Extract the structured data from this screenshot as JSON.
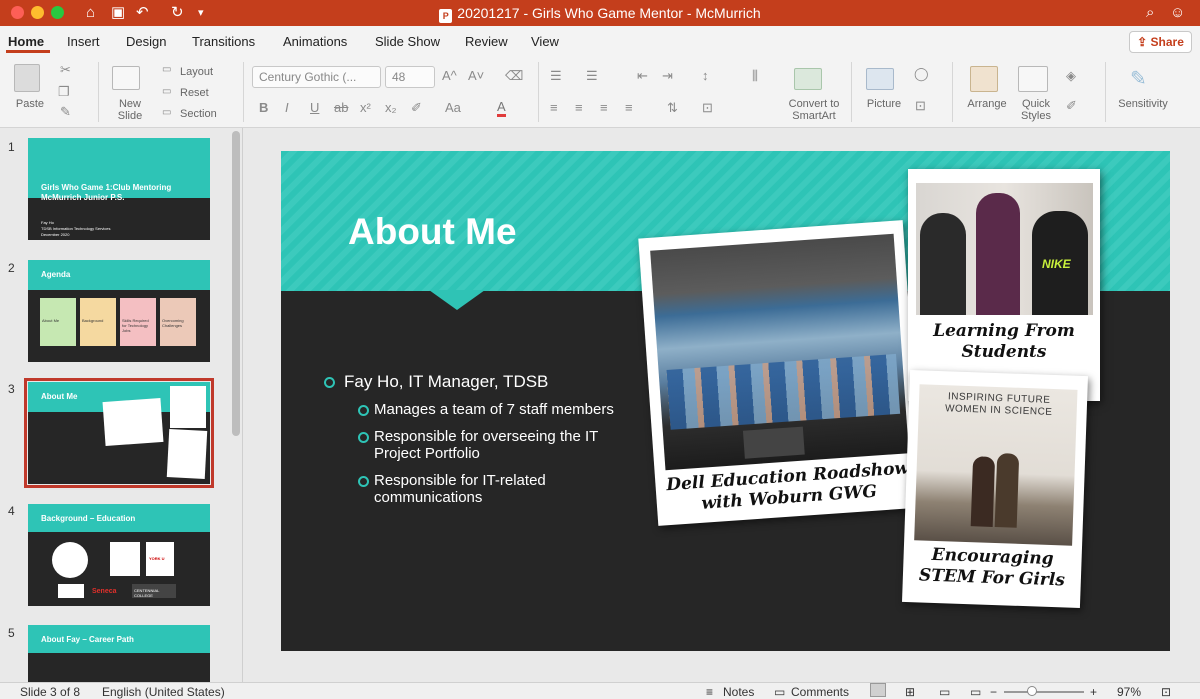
{
  "app": {
    "title": "20201217 - Girls Who Game Mentor - McMurrich",
    "ppt_mark": "P"
  },
  "tabs": [
    "Home",
    "Insert",
    "Design",
    "Transitions",
    "Animations",
    "Slide Show",
    "Review",
    "View"
  ],
  "share_label": "Share",
  "ribbon": {
    "paste": "Paste",
    "new_slide": "New\nSlide",
    "layout": "Layout",
    "reset": "Reset",
    "section": "Section",
    "font_name": "Century Gothic (...",
    "font_size": "48",
    "bold": "B",
    "italic": "I",
    "underline": "U",
    "strike": "ab",
    "superscript": "x²",
    "subscript": "x₂",
    "font_grow": "A^",
    "font_shrink": "A˅",
    "change_case": "Aa",
    "font_color": "A",
    "convert_smartart": "Convert to\nSmartArt",
    "picture": "Picture",
    "arrange": "Arrange",
    "quick_styles": "Quick\nStyles",
    "sensitivity": "Sensitivity"
  },
  "thumbnails": [
    {
      "num": "1",
      "title": "Girls Who Game 1:Club Mentoring McMurrich Junior P.S.",
      "sub": [
        "Fay Ho",
        "TDSB Information Technology Services",
        "December 2020"
      ]
    },
    {
      "num": "2",
      "title": "Agenda",
      "items": [
        "About Me",
        "Background",
        "Skills Required for Technology Jobs",
        "Overcoming Challenges"
      ]
    },
    {
      "num": "3",
      "title": "About Me"
    },
    {
      "num": "4",
      "title": "Background – Education",
      "logos": [
        "Seneca",
        "CENTENNIAL COLLEGE",
        "YORK U"
      ]
    },
    {
      "num": "5",
      "title": "About Fay – Career Path"
    }
  ],
  "slide": {
    "title": "About Me",
    "bullets": [
      {
        "level": 1,
        "text": "Fay Ho, IT Manager, TDSB"
      },
      {
        "level": 2,
        "text": "Manages a team of 7 staff members"
      },
      {
        "level": 2,
        "text": "Responsible for overseeing the IT Project Portfolio"
      },
      {
        "level": 2,
        "text": "Responsible for IT-related communications"
      }
    ],
    "photos": [
      {
        "caption": "Dell Education Roadshow with Woburn GWG"
      },
      {
        "caption": "Learning From Students"
      },
      {
        "caption": "Encouraging STEM For Girls"
      }
    ],
    "photo_text": {
      "nike": "NIKE",
      "inspiring": "INSPIRING FUTURE WOMEN IN SCIENCE"
    }
  },
  "status": {
    "slide_counter": "Slide 3 of 8",
    "language": "English (United States)",
    "notes": "Notes",
    "comments": "Comments",
    "zoom": "97%"
  },
  "colors": {
    "accent": "#c43e1c",
    "teal": "#2ec4b6",
    "slide_bg": "#262626"
  }
}
